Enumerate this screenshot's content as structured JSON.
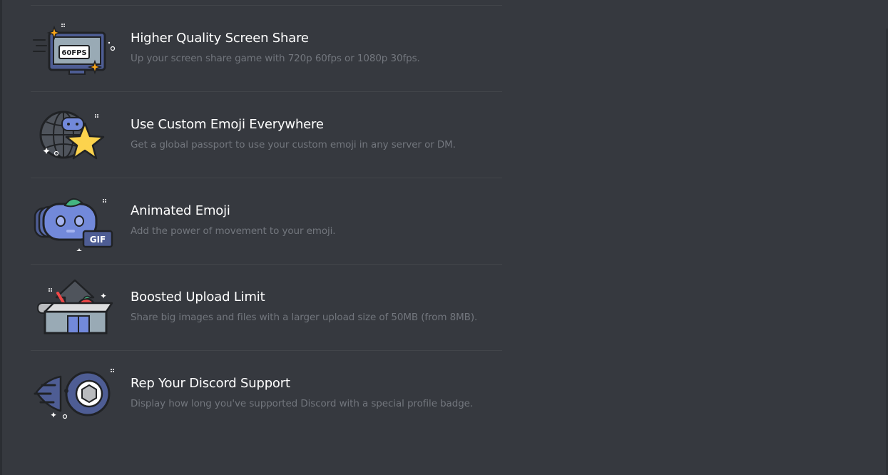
{
  "colors": {
    "background": "#36393f",
    "title": "#ffffff",
    "description": "#72767d",
    "divider": "#42454a",
    "blurple": "#7289da"
  },
  "perks": [
    {
      "icon": "screen-share-60fps-icon",
      "icon_label": "60FPS",
      "title": "Higher Quality Screen Share",
      "description": "Up your screen share game with 720p 60fps or 1080p 30fps."
    },
    {
      "icon": "globe-star-emoji-icon",
      "title": "Use Custom Emoji Everywhere",
      "description": "Get a global passport to use your custom emoji in any server or DM."
    },
    {
      "icon": "animated-gif-emoji-icon",
      "icon_label": "GIF",
      "title": "Animated Emoji",
      "description": "Add the power of movement to your emoji."
    },
    {
      "icon": "upload-box-icon",
      "title": "Boosted Upload Limit",
      "description": "Share big images and files with a larger upload size of 50MB (from 8MB)."
    },
    {
      "icon": "profile-badge-icon",
      "title": "Rep Your Discord Support",
      "description": "Display how long you've supported Discord with a special profile badge."
    }
  ]
}
